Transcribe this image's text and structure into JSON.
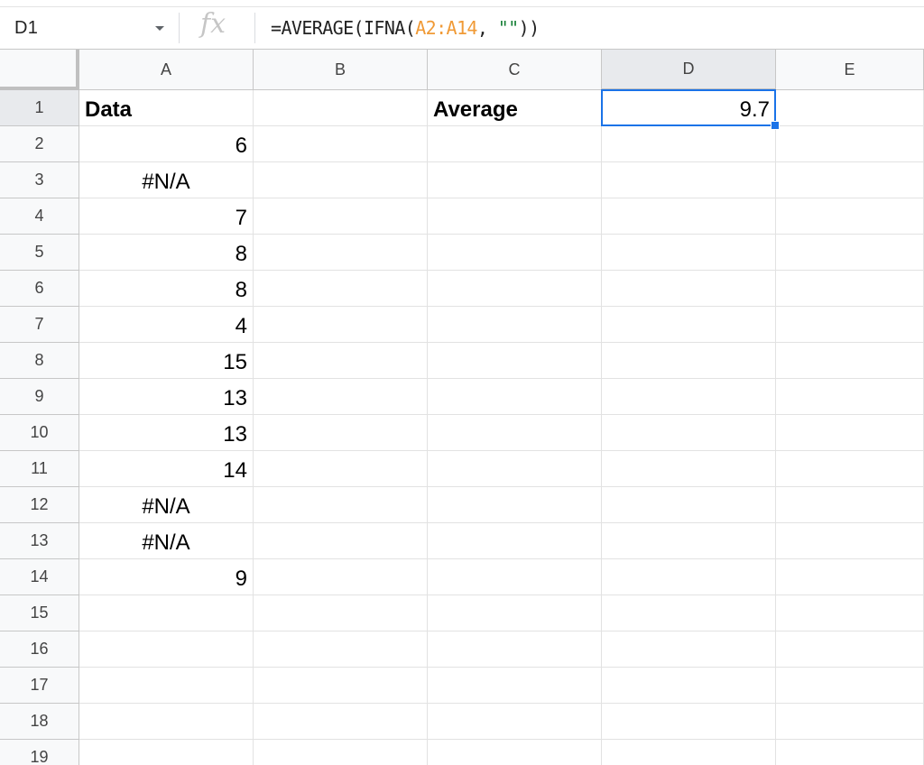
{
  "name_box": {
    "cell_ref": "D1"
  },
  "formula_bar": {
    "fx_label": "fx",
    "formula_parts": [
      {
        "text": "=AVERAGE(IFNA(",
        "kind": "plain"
      },
      {
        "text": "A2:A14",
        "kind": "ref"
      },
      {
        "text": ", ",
        "kind": "plain"
      },
      {
        "text": "\"\"",
        "kind": "str"
      },
      {
        "text": "))",
        "kind": "plain"
      }
    ]
  },
  "columns": [
    "A",
    "B",
    "C",
    "D",
    "E"
  ],
  "rows": [
    "1",
    "2",
    "3",
    "4",
    "5",
    "6",
    "7",
    "8",
    "9",
    "10",
    "11",
    "12",
    "13",
    "14",
    "15",
    "16",
    "17",
    "18",
    "19"
  ],
  "selected_cell": {
    "col": "D",
    "row": "1"
  },
  "cells": [
    {
      "ref": "A1",
      "value": "Data",
      "align": "left",
      "bold": true
    },
    {
      "ref": "C1",
      "value": "Average",
      "align": "left",
      "bold": true
    },
    {
      "ref": "D1",
      "value": "9.7",
      "align": "right",
      "bold": false
    },
    {
      "ref": "A2",
      "value": "6",
      "align": "right",
      "bold": false
    },
    {
      "ref": "A3",
      "value": "#N/A",
      "align": "center",
      "bold": false
    },
    {
      "ref": "A4",
      "value": "7",
      "align": "right",
      "bold": false
    },
    {
      "ref": "A5",
      "value": "8",
      "align": "right",
      "bold": false
    },
    {
      "ref": "A6",
      "value": "8",
      "align": "right",
      "bold": false
    },
    {
      "ref": "A7",
      "value": "4",
      "align": "right",
      "bold": false
    },
    {
      "ref": "A8",
      "value": "15",
      "align": "right",
      "bold": false
    },
    {
      "ref": "A9",
      "value": "13",
      "align": "right",
      "bold": false
    },
    {
      "ref": "A10",
      "value": "13",
      "align": "right",
      "bold": false
    },
    {
      "ref": "A11",
      "value": "14",
      "align": "right",
      "bold": false
    },
    {
      "ref": "A12",
      "value": "#N/A",
      "align": "center",
      "bold": false
    },
    {
      "ref": "A13",
      "value": "#N/A",
      "align": "center",
      "bold": false
    },
    {
      "ref": "A14",
      "value": "9",
      "align": "right",
      "bold": false
    }
  ]
}
